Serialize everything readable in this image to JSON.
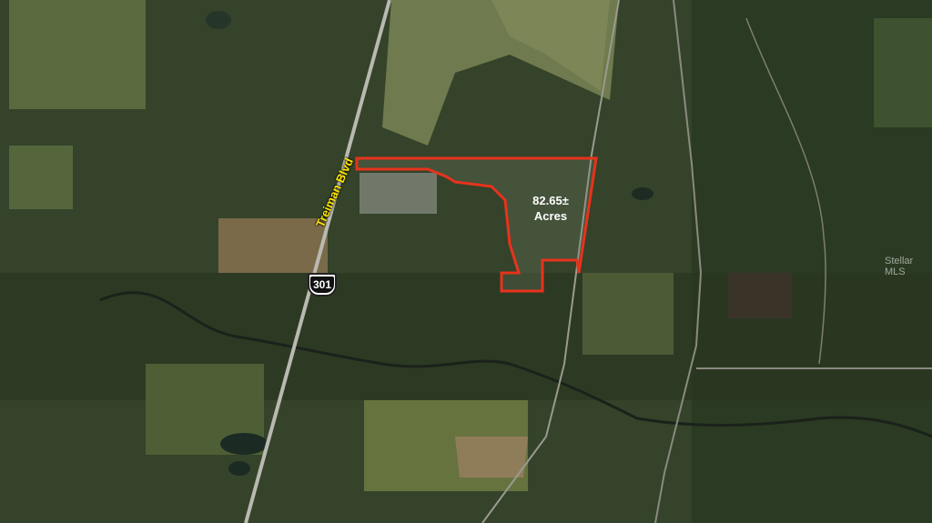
{
  "map": {
    "road_name": "Treiman Blvd",
    "route_number": "301",
    "parcel": {
      "acreage": "82.65±",
      "unit": "Acres",
      "outline_color": "#e8321c"
    },
    "watermark": "Stellar MLS"
  }
}
